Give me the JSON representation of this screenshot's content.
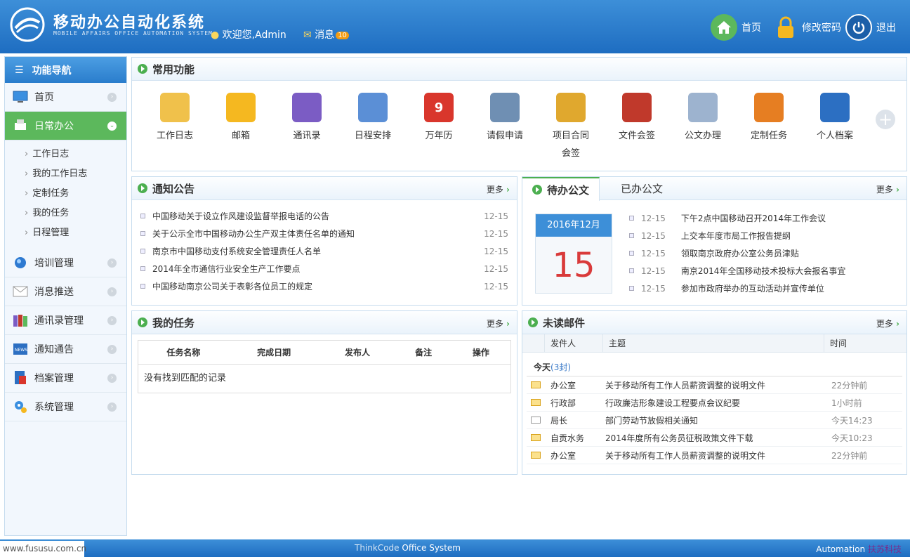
{
  "header": {
    "title": "移动办公自动化系统",
    "subtitle": "MOBILE AFFAIRS OFFICE AUTOMATION SYSTEM",
    "welcome": "欢迎您,Admin",
    "messages_label": "消息",
    "messages_count": "10",
    "nav": {
      "home": "首页",
      "change_password": "修改密码",
      "logout": "退出"
    }
  },
  "sidebar": {
    "title": "功能导航",
    "items": [
      {
        "label": "首页"
      },
      {
        "label": "日常办公"
      },
      {
        "label": "培训管理"
      },
      {
        "label": "消息推送"
      },
      {
        "label": "通讯录管理"
      },
      {
        "label": "通知通告"
      },
      {
        "label": "档案管理"
      },
      {
        "label": "系统管理"
      }
    ],
    "subitems": [
      "工作日志",
      "我的工作日志",
      "定制任务",
      "我的任务",
      "日程管理"
    ]
  },
  "common": {
    "title": "常用功能",
    "items": [
      {
        "label": "工作日志",
        "color": "#f0c14b"
      },
      {
        "label": "邮箱",
        "color": "#f5b820"
      },
      {
        "label": "通讯录",
        "color": "#7b5cc4"
      },
      {
        "label": "日程安排",
        "color": "#5b8fd6"
      },
      {
        "label": "万年历",
        "color": "#d9362c",
        "glyph": "9"
      },
      {
        "label": "请假申请",
        "color": "#6f8fb3"
      },
      {
        "label": "项目合同",
        "label2": "会签",
        "color": "#e0a82e"
      },
      {
        "label": "文件会签",
        "color": "#c0392b"
      },
      {
        "label": "公文办理",
        "color": "#9db3cf"
      },
      {
        "label": "定制任务",
        "color": "#e67e22"
      },
      {
        "label": "个人档案",
        "color": "#2c6fc2"
      }
    ]
  },
  "notice": {
    "title": "通知公告",
    "more": "更多",
    "items": [
      {
        "title": "中国移动关于设立作风建设监督举报电话的公告",
        "date": "12-15"
      },
      {
        "title": "关于公示全市中国移动办公生产双主体责任名单的通知",
        "date": "12-15"
      },
      {
        "title": "南京市中国移动支付系统安全管理责任人名单",
        "date": "12-15"
      },
      {
        "title": "2014年全市通信行业安全生产工作要点",
        "date": "12-15"
      },
      {
        "title": "中国移动南京公司关于表彰各位员工的规定",
        "date": "12-15"
      }
    ]
  },
  "docs": {
    "tab_pending": "待办公文",
    "tab_done": "已办公文",
    "more": "更多",
    "calendar_month": "2016年12月",
    "calendar_day": "15",
    "items": [
      {
        "date": "12-15",
        "title": "下午2点中国移动召开2014年工作会议"
      },
      {
        "date": "12-15",
        "title": "上交本年度市局工作报告提纲"
      },
      {
        "date": "12-15",
        "title": "领取南京政府办公室公务员津贴"
      },
      {
        "date": "12-15",
        "title": "南京2014年全国移动技术投标大会报名事宜"
      },
      {
        "date": "12-15",
        "title": "参加市政府举办的互动活动并宣传单位"
      }
    ]
  },
  "tasks": {
    "title": "我的任务",
    "more": "更多",
    "columns": [
      "任务名称",
      "完成日期",
      "发布人",
      "备注",
      "操作"
    ],
    "empty": "没有找到匹配的记录"
  },
  "mail": {
    "title": "未读邮件",
    "more": "更多",
    "columns": [
      "发件人",
      "主题",
      "时间"
    ],
    "today_label": "今天",
    "today_count": "(3封)",
    "rows": [
      {
        "from": "办公室",
        "subject": "关于移动所有工作人员薪资调整的说明文件",
        "time": "22分钟前",
        "read": false
      },
      {
        "from": "行政部",
        "subject": "行政廉洁形象建设工程要点会议纪要",
        "time": "1小时前",
        "read": false
      },
      {
        "from": "局长",
        "subject": "部门劳动节放假相关通知",
        "time": "今天14:23",
        "read": true
      },
      {
        "from": "自贡水务",
        "subject": "2014年度所有公务员征税政策文件下载",
        "time": "今天10:23",
        "read": false
      },
      {
        "from": "办公室",
        "subject": "关于移动所有工作人员薪资调整的说明文件",
        "time": "22分钟前",
        "read": false
      }
    ]
  },
  "footer": {
    "url": "www.fususu.com.cn",
    "brand_a": "ThinkCode",
    "brand_b": "Office System",
    "right_a": "Automation",
    "right_b": "扶苏科技"
  }
}
